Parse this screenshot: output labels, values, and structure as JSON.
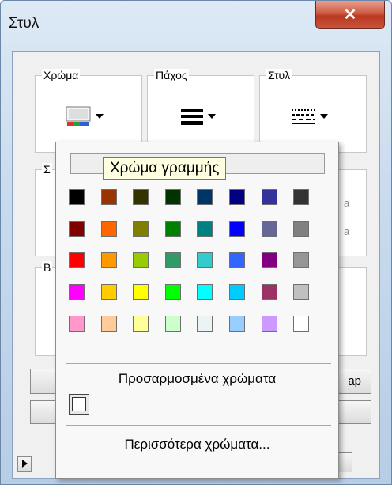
{
  "window": {
    "title": "Στυλ",
    "close_glyph": "✕"
  },
  "groups": {
    "color": {
      "label": "Χρώμα",
      "icon": "color-swatch-icon"
    },
    "thickness": {
      "label": "Πάχος",
      "icon": "line-thickness-icon"
    },
    "style": {
      "label": "Στυλ",
      "icon": "dash-style-icon"
    },
    "partial_label_1": "Σ",
    "partial_label_2": "Β",
    "partial_text_3": "ap"
  },
  "popup": {
    "tooltip": "Χρώμα γραμμής",
    "palette": [
      [
        "#000000",
        "#993300",
        "#333300",
        "#003300",
        "#003366",
        "#000080",
        "#333399",
        "#333333"
      ],
      [
        "#800000",
        "#ff6600",
        "#808000",
        "#008000",
        "#008080",
        "#0000ff",
        "#666699",
        "#808080"
      ],
      [
        "#ff0000",
        "#ff9900",
        "#99cc00",
        "#339966",
        "#33cccc",
        "#3366ff",
        "#800080",
        "#969696"
      ],
      [
        "#ff00ff",
        "#ffcc00",
        "#ffff00",
        "#00ff00",
        "#00ffff",
        "#00ccff",
        "#993366",
        "#c0c0c0"
      ],
      [
        "#ff99cc",
        "#ffcc99",
        "#ffff99",
        "#ccffcc",
        "#eaf4f4",
        "#99ccff",
        "#cc99ff",
        "#ffffff"
      ]
    ],
    "custom_colors_label": "Προσαρμοσμένα χρώματα",
    "more_colors_label": "Περισσότερα χρώματα..."
  }
}
